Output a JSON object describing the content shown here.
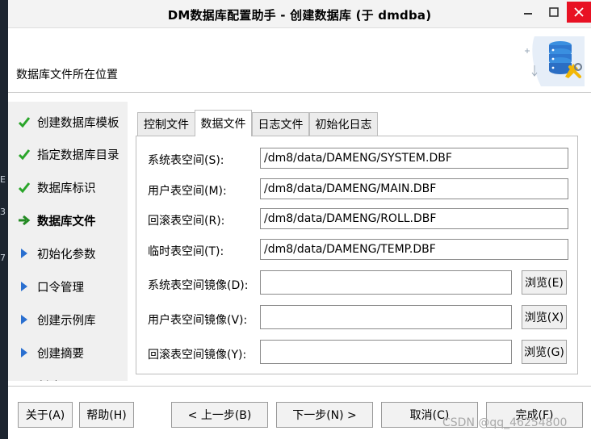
{
  "desktop": {
    "edge_chars": [
      "E",
      "3",
      "7"
    ]
  },
  "window": {
    "title": "DM数据库配置助手 - 创建数据库 (于 dmdba)",
    "header_label": "数据库文件所在位置"
  },
  "steps": [
    {
      "label": "创建数据库模板",
      "state": "done",
      "icon": "check-icon"
    },
    {
      "label": "指定数据库目录",
      "state": "done",
      "icon": "check-icon"
    },
    {
      "label": "数据库标识",
      "state": "done",
      "icon": "check-icon"
    },
    {
      "label": "数据库文件",
      "state": "current",
      "icon": "arrow-right-icon"
    },
    {
      "label": "初始化参数",
      "state": "pending",
      "icon": "triangle-right-icon"
    },
    {
      "label": "口令管理",
      "state": "pending",
      "icon": "triangle-right-icon"
    },
    {
      "label": "创建示例库",
      "state": "pending",
      "icon": "triangle-right-icon"
    },
    {
      "label": "创建摘要",
      "state": "pending",
      "icon": "triangle-right-icon"
    },
    {
      "label": "创建",
      "state": "pending",
      "icon": "triangle-right-icon"
    }
  ],
  "tabs": [
    {
      "label": "控制文件",
      "active": false
    },
    {
      "label": "数据文件",
      "active": true
    },
    {
      "label": "日志文件",
      "active": false
    },
    {
      "label": "初始化日志",
      "active": false
    }
  ],
  "fields": {
    "system": {
      "label": "系统表空间(S):",
      "value": "/dm8/data/DAMENG/SYSTEM.DBF"
    },
    "main": {
      "label": "用户表空间(M):",
      "value": "/dm8/data/DAMENG/MAIN.DBF"
    },
    "roll": {
      "label": "回滚表空间(R):",
      "value": "/dm8/data/DAMENG/ROLL.DBF"
    },
    "temp": {
      "label": "临时表空间(T):",
      "value": "/dm8/data/DAMENG/TEMP.DBF"
    },
    "system_mirror": {
      "label": "系统表空间镜像(D):",
      "value": "",
      "browse": "浏览(E)"
    },
    "user_mirror": {
      "label": "用户表空间镜像(V):",
      "value": "",
      "browse": "浏览(X)"
    },
    "roll_mirror": {
      "label": "回滚表空间镜像(Y):",
      "value": "",
      "browse": "浏览(G)"
    }
  },
  "buttons": {
    "about": "关于(A)",
    "help": "帮助(H)",
    "prev": "< 上一步(B)",
    "next": "下一步(N) >",
    "cancel": "取消(C)",
    "finish": "完成(F)"
  },
  "watermark": "CSDN @qq_46254800",
  "colors": {
    "check": "#2aa52a",
    "arrow": "#238a23",
    "triangle": "#2a6fd0",
    "close_button": "#e81123"
  }
}
